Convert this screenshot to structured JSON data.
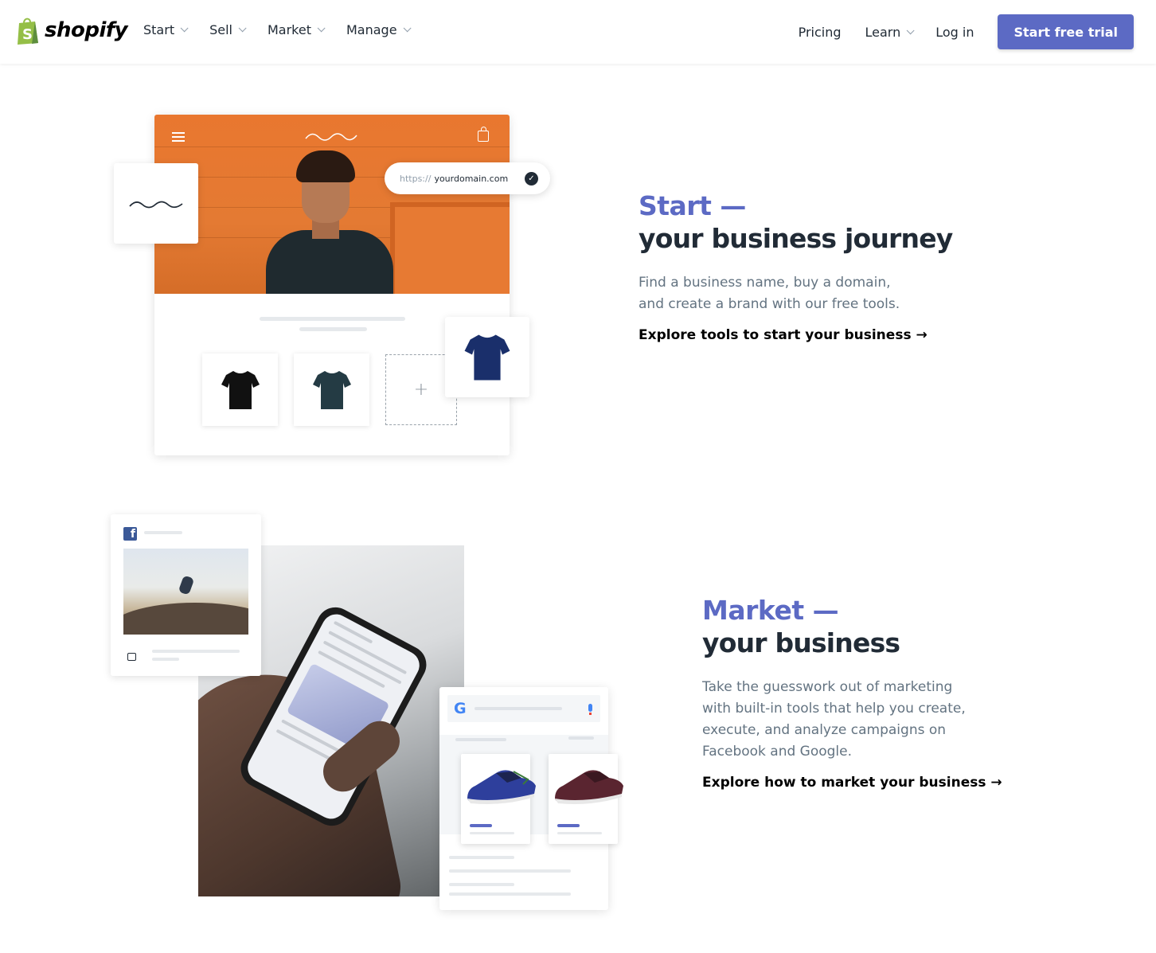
{
  "brand": {
    "name": "shopify",
    "accent": "#5c6ac4",
    "logo_green": "#95bf47"
  },
  "nav": {
    "left": [
      {
        "label": "Start",
        "has_dropdown": true
      },
      {
        "label": "Sell",
        "has_dropdown": true
      },
      {
        "label": "Market",
        "has_dropdown": true
      },
      {
        "label": "Manage",
        "has_dropdown": true
      }
    ],
    "pricing": "Pricing",
    "learn": "Learn",
    "login": "Log in",
    "cta": "Start free trial"
  },
  "start_section": {
    "eyebrow": "Start —",
    "headline": "your business journey",
    "body_line1": "Find a business name, buy a domain,",
    "body_line2": "and create a brand with our free tools.",
    "link": "Explore tools to start your business →",
    "illustration": {
      "domain_protocol": "https://",
      "domain_name": "yourdomain.com",
      "add_symbol": "+"
    }
  },
  "market_section": {
    "eyebrow": "Market —",
    "headline": "your business",
    "body_line1": "Take the guesswork out of marketing",
    "body_line2": "with built-in tools that help you create,",
    "body_line3": "execute, and analyze campaigns on",
    "body_line4": "Facebook and Google.",
    "link": "Explore how to market your business →",
    "illustration": {
      "facebook_glyph": "f",
      "google_glyph": "G"
    }
  }
}
